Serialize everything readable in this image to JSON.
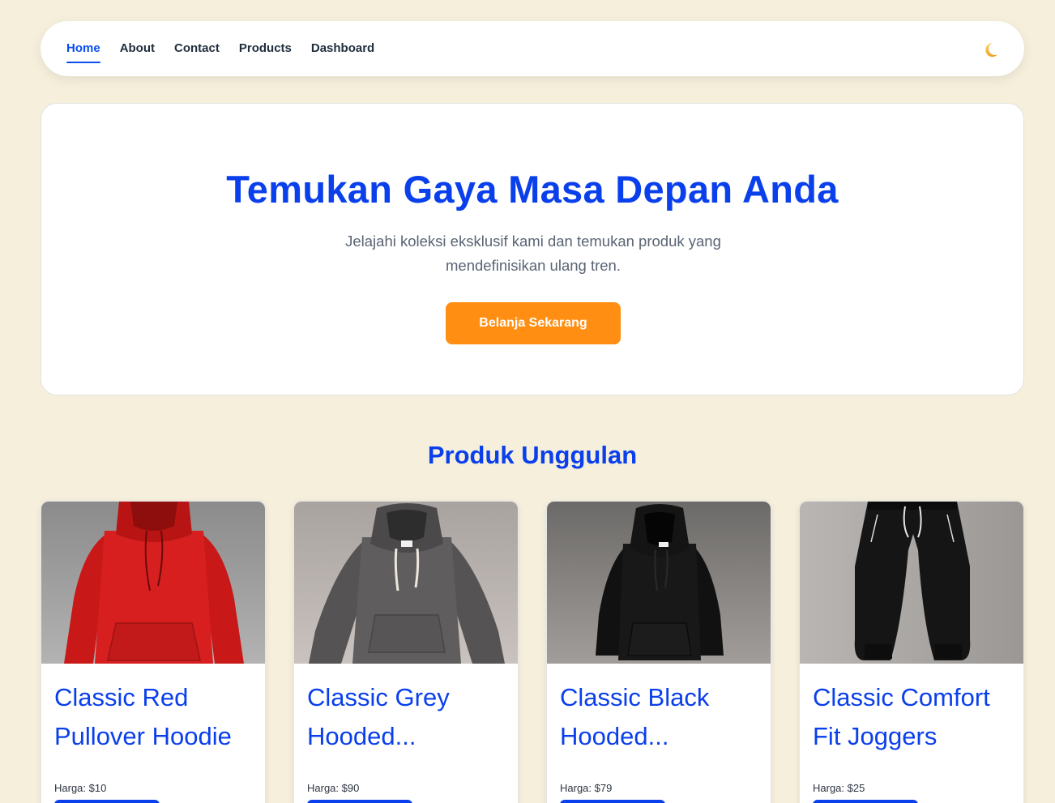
{
  "nav": {
    "links": [
      {
        "label": "Home",
        "active": true
      },
      {
        "label": "About"
      },
      {
        "label": "Contact"
      },
      {
        "label": "Products"
      },
      {
        "label": "Dashboard"
      }
    ],
    "theme_toggle_icon": "crescent-moon-icon"
  },
  "hero": {
    "title": "Temukan Gaya Masa Depan Anda",
    "subtitle": "Jelajahi koleksi eksklusif kami dan temukan produk yang mendefinisikan ulang tren.",
    "cta_label": "Belanja Sekarang"
  },
  "featured": {
    "title": "Produk Unggulan",
    "products": [
      {
        "name": "Classic Red Pullover Hoodie",
        "display_name": "Classic Red Pullover Hoodie",
        "price": "Harga: $10",
        "image": "red-hoodie",
        "color": "#d71f1f"
      },
      {
        "name": "Classic Grey Hooded Sweatshirt",
        "display_name": "Classic Grey Hooded...",
        "price": "Harga: $90",
        "image": "grey-hoodie",
        "color": "#5d5b5b"
      },
      {
        "name": "Classic Black Hooded Sweatshirt",
        "display_name": "Classic Black Hooded...",
        "price": "Harga: $79",
        "image": "black-hoodie",
        "color": "#151515"
      },
      {
        "name": "Classic Comfort Fit Joggers",
        "display_name": "Classic Comfort Fit Joggers",
        "price": "Harga: $25",
        "image": "black-joggers",
        "color": "#121212"
      }
    ]
  },
  "colors": {
    "page_background": "#f5efdc",
    "primary": "#0a3fec",
    "cta": "#ff8e12"
  }
}
